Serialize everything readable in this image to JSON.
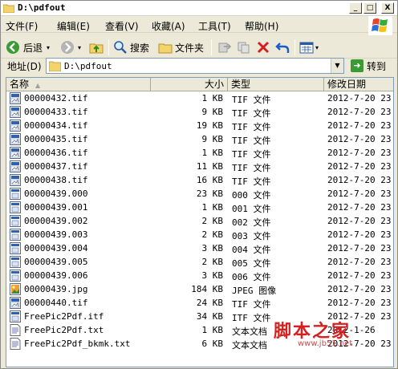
{
  "window": {
    "title": "D:\\pdfout",
    "buttons": {
      "minimize": "_",
      "maximize": "□",
      "close": "X"
    }
  },
  "menubar": [
    {
      "label": "文件(F)"
    },
    {
      "label": "编辑(E)"
    },
    {
      "label": "查看(V)"
    },
    {
      "label": "收藏(A)"
    },
    {
      "label": "工具(T)"
    },
    {
      "label": "帮助(H)"
    }
  ],
  "toolbar": {
    "back_label": "后退",
    "search_label": "搜索",
    "folders_label": "文件夹"
  },
  "address": {
    "label": "地址(D)",
    "value": "D:\\pdfout",
    "go_label": "转到"
  },
  "columns": {
    "name": "名称",
    "size": "大小",
    "type": "类型",
    "modified": "修改日期"
  },
  "files": [
    {
      "name": "00000432.tif",
      "size": "1 KB",
      "type": "TIF 文件",
      "modified": "2012-7-20 23",
      "icon": "tif-file-icon"
    },
    {
      "name": "00000433.tif",
      "size": "9 KB",
      "type": "TIF 文件",
      "modified": "2012-7-20 23",
      "icon": "tif-file-icon"
    },
    {
      "name": "00000434.tif",
      "size": "19 KB",
      "type": "TIF 文件",
      "modified": "2012-7-20 23",
      "icon": "tif-file-icon"
    },
    {
      "name": "00000435.tif",
      "size": "9 KB",
      "type": "TIF 文件",
      "modified": "2012-7-20 23",
      "icon": "tif-file-icon"
    },
    {
      "name": "00000436.tif",
      "size": "1 KB",
      "type": "TIF 文件",
      "modified": "2012-7-20 23",
      "icon": "tif-file-icon"
    },
    {
      "name": "00000437.tif",
      "size": "11 KB",
      "type": "TIF 文件",
      "modified": "2012-7-20 23",
      "icon": "tif-file-icon"
    },
    {
      "name": "00000438.tif",
      "size": "16 KB",
      "type": "TIF 文件",
      "modified": "2012-7-20 23",
      "icon": "tif-file-icon"
    },
    {
      "name": "00000439.000",
      "size": "23 KB",
      "type": "000 文件",
      "modified": "2012-7-20 23",
      "icon": "generic-file-icon"
    },
    {
      "name": "00000439.001",
      "size": "1 KB",
      "type": "001 文件",
      "modified": "2012-7-20 23",
      "icon": "generic-file-icon"
    },
    {
      "name": "00000439.002",
      "size": "2 KB",
      "type": "002 文件",
      "modified": "2012-7-20 23",
      "icon": "generic-file-icon"
    },
    {
      "name": "00000439.003",
      "size": "2 KB",
      "type": "003 文件",
      "modified": "2012-7-20 23",
      "icon": "generic-file-icon"
    },
    {
      "name": "00000439.004",
      "size": "3 KB",
      "type": "004 文件",
      "modified": "2012-7-20 23",
      "icon": "generic-file-icon"
    },
    {
      "name": "00000439.005",
      "size": "2 KB",
      "type": "005 文件",
      "modified": "2012-7-20 23",
      "icon": "generic-file-icon"
    },
    {
      "name": "00000439.006",
      "size": "3 KB",
      "type": "006 文件",
      "modified": "2012-7-20 23",
      "icon": "generic-file-icon"
    },
    {
      "name": "00000439.jpg",
      "size": "184 KB",
      "type": "JPEG 图像",
      "modified": "2012-7-20 23",
      "icon": "jpeg-image-icon"
    },
    {
      "name": "00000440.tif",
      "size": "24 KB",
      "type": "TIF 文件",
      "modified": "2012-7-20 23",
      "icon": "tif-file-icon"
    },
    {
      "name": "FreePic2Pdf.itf",
      "size": "34 KB",
      "type": "ITF 文件",
      "modified": "2012-7-20 23",
      "icon": "generic-file-icon"
    },
    {
      "name": "FreePic2Pdf.txt",
      "size": "1 KB",
      "type": "文本文档",
      "modified": "2012-1-26",
      "icon": "text-document-icon"
    },
    {
      "name": "FreePic2Pdf_bkmk.txt",
      "size": "6 KB",
      "type": "文本文档",
      "modified": "2012-7-20 23",
      "icon": "text-document-icon"
    }
  ],
  "watermark": {
    "text": "脚本之家",
    "url": "www.jb51.net"
  },
  "colors": {
    "window_face": "#ece9d8",
    "list_border": "#7f9db9",
    "watermark": "#d42020"
  }
}
